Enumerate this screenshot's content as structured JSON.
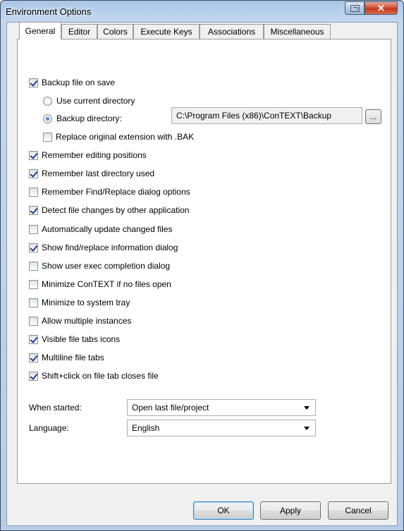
{
  "window": {
    "title": "Environment Options"
  },
  "icons": {
    "help": "help-restore-icon",
    "close": "close-icon",
    "check": "checkmark",
    "dropdown": "chevron-down-icon",
    "radio": "radio-dot"
  },
  "colors": {
    "accent": "#1e3c8c",
    "close_button": "#c2391c",
    "default_button_border": "#3c7fb1"
  },
  "tabs": [
    "General",
    "Editor",
    "Colors",
    "Execute Keys",
    "Associations",
    "Miscellaneous"
  ],
  "active_tab": "General",
  "backup": {
    "label": "Backup file on save",
    "checked": true,
    "use_current": "Use current directory",
    "backup_dir": "Backup directory:",
    "selected": "backup_dir",
    "path": "C:\\Program Files (x86)\\ConTEXT\\Backup",
    "browse": "...",
    "replace_ext": "Replace original extension with .BAK",
    "replace_ext_checked": false
  },
  "options": [
    {
      "label": "Remember editing positions",
      "checked": true
    },
    {
      "label": "Remember last directory used",
      "checked": true
    },
    {
      "label": "Remember Find/Replace dialog options",
      "checked": false
    },
    {
      "label": "Detect file changes by other application",
      "checked": true
    },
    {
      "label": "Automatically update changed files",
      "checked": false
    },
    {
      "label": "Show find/replace information dialog",
      "checked": true
    },
    {
      "label": "Show user exec completion dialog",
      "checked": false
    },
    {
      "label": "Minimize ConTEXT if no files open",
      "checked": false
    },
    {
      "label": "Minimize to system tray",
      "checked": false
    },
    {
      "label": "Allow multiple instances",
      "checked": false
    },
    {
      "label": "Visible file tabs icons",
      "checked": true
    },
    {
      "label": "Multiline file tabs",
      "checked": true
    },
    {
      "label": "Shift+click on file tab closes file",
      "checked": true
    }
  ],
  "when_started": {
    "label": "When started:",
    "value": "Open last file/project"
  },
  "language": {
    "label": "Language:",
    "value": "English"
  },
  "buttons": {
    "ok": "OK",
    "apply": "Apply",
    "cancel": "Cancel"
  }
}
